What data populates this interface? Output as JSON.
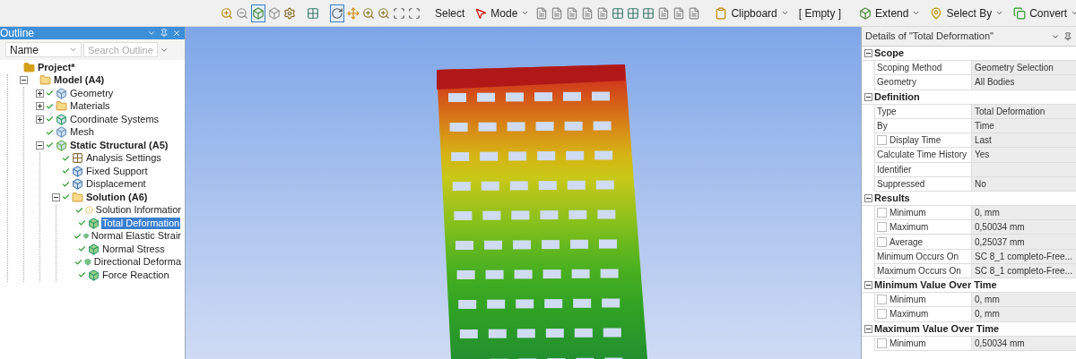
{
  "toolbar": {
    "items": [
      {
        "kind": "button"
      },
      {
        "kind": "button"
      },
      {
        "kind": "button",
        "selected": true
      },
      {
        "kind": "button",
        "selected": false
      },
      {
        "kind": "button",
        "selected": false
      },
      {
        "kind": "sep"
      },
      {
        "kind": "button"
      },
      {
        "kind": "sep"
      },
      {
        "kind": "button",
        "selected": true
      },
      {
        "kind": "button"
      },
      {
        "kind": "button"
      },
      {
        "kind": "button"
      },
      {
        "kind": "button"
      },
      {
        "kind": "button"
      },
      {
        "kind": "sep"
      },
      {
        "kind": "text",
        "label": "Select"
      },
      {
        "kind": "menu",
        "label": "Mode"
      },
      {
        "kind": "button"
      },
      {
        "kind": "button"
      },
      {
        "kind": "button"
      },
      {
        "kind": "button"
      },
      {
        "kind": "button"
      },
      {
        "kind": "button"
      },
      {
        "kind": "button"
      },
      {
        "kind": "button"
      },
      {
        "kind": "button"
      },
      {
        "kind": "button"
      },
      {
        "kind": "button"
      },
      {
        "kind": "sep"
      },
      {
        "kind": "menu",
        "label": "Clipboard"
      },
      {
        "kind": "text",
        "label": "[ Empty ]"
      },
      {
        "kind": "sep"
      },
      {
        "kind": "menu",
        "label": "Extend"
      },
      {
        "kind": "menu",
        "label": "Select By"
      },
      {
        "kind": "menu",
        "label": "Convert"
      }
    ]
  },
  "outline": {
    "title": "Outline",
    "filter": "Name",
    "search_placeholder": "Search Outline",
    "tree": [
      {
        "label": "Project*",
        "bold": true,
        "kind": "project",
        "checked": false,
        "selected": false,
        "children": [
          {
            "label": "Model (A4)",
            "bold": true,
            "kind": "folder",
            "checked": false,
            "selected": false,
            "expanded": true,
            "children": [
              {
                "label": "Geometry",
                "bold": false,
                "kind": "geometry",
                "checked": true,
                "selected": false,
                "expanded": false
              },
              {
                "label": "Materials",
                "bold": false,
                "kind": "folder",
                "checked": true,
                "selected": false,
                "expanded": false
              },
              {
                "label": "Coordinate Systems",
                "bold": false,
                "kind": "axes",
                "checked": true,
                "selected": false,
                "expanded": false
              },
              {
                "label": "Mesh",
                "bold": false,
                "kind": "geometry",
                "checked": true,
                "selected": false
              },
              {
                "label": "Static Structural (A5)",
                "bold": true,
                "kind": "analysis",
                "checked": true,
                "selected": false,
                "expanded": true,
                "children": [
                  {
                    "label": "Analysis Settings",
                    "bold": false,
                    "kind": "settings",
                    "checked": true,
                    "selected": false
                  },
                  {
                    "label": "Fixed Support",
                    "bold": false,
                    "kind": "support",
                    "checked": true,
                    "selected": false
                  },
                  {
                    "label": "Displacement",
                    "bold": false,
                    "kind": "support",
                    "checked": true,
                    "selected": false
                  },
                  {
                    "label": "Solution (A6)",
                    "bold": true,
                    "kind": "folder",
                    "checked": true,
                    "selected": false,
                    "expanded": true,
                    "children": [
                      {
                        "label": "Solution Informatior",
                        "bold": false,
                        "kind": "info",
                        "checked": true,
                        "selected": false
                      },
                      {
                        "label": "Total Deformation",
                        "bold": false,
                        "kind": "result",
                        "checked": true,
                        "selected": true
                      },
                      {
                        "label": "Normal Elastic Strair",
                        "bold": false,
                        "kind": "result",
                        "checked": true,
                        "selected": false
                      },
                      {
                        "label": "Normal Stress",
                        "bold": false,
                        "kind": "result",
                        "checked": true,
                        "selected": false
                      },
                      {
                        "label": "Directional Deforma",
                        "bold": false,
                        "kind": "result",
                        "checked": true,
                        "selected": false
                      },
                      {
                        "label": "Force Reaction",
                        "bold": false,
                        "kind": "result",
                        "checked": true,
                        "selected": false
                      }
                    ]
                  }
                ]
              }
            ]
          }
        ]
      }
    ]
  },
  "details": {
    "title": "Details of \"Total Deformation\"",
    "sections": [
      {
        "title": "Scope",
        "expanded": true,
        "rows": [
          {
            "label": "Scoping Method",
            "value": "Geometry Selection"
          },
          {
            "label": "Geometry",
            "value": "All Bodies"
          }
        ]
      },
      {
        "title": "Definition",
        "expanded": true,
        "rows": [
          {
            "label": "Type",
            "value": "Total Deformation"
          },
          {
            "label": "By",
            "value": "Time"
          },
          {
            "label": "Display Time",
            "value": "Last",
            "checked": false
          },
          {
            "label": "Calculate Time History",
            "value": "Yes"
          },
          {
            "label": "Identifier"
          },
          {
            "label": "Suppressed",
            "value": "No"
          }
        ]
      },
      {
        "title": "Results",
        "expanded": true,
        "rows": [
          {
            "label": "Minimum",
            "value": "0, mm",
            "checked": false
          },
          {
            "label": "Maximum",
            "value": "0,50034 mm",
            "checked": false
          },
          {
            "label": "Average",
            "value": "0,25037 mm",
            "checked": false
          },
          {
            "label": "Minimum Occurs On",
            "value": "SC 8_1 completo-Free..."
          },
          {
            "label": "Maximum Occurs On",
            "value": "SC 8_1 completo-Free..."
          }
        ]
      },
      {
        "title": "Minimum Value Over Time",
        "expanded": true,
        "rows": [
          {
            "label": "Minimum",
            "value": "0, mm",
            "checked": false
          },
          {
            "label": "Maximum",
            "value": "0, mm",
            "checked": false
          }
        ]
      },
      {
        "title": "Maximum Value Over Time",
        "expanded": true,
        "rows": [
          {
            "label": "Minimum",
            "value": "0,50034 mm",
            "checked": false
          }
        ]
      }
    ]
  }
}
